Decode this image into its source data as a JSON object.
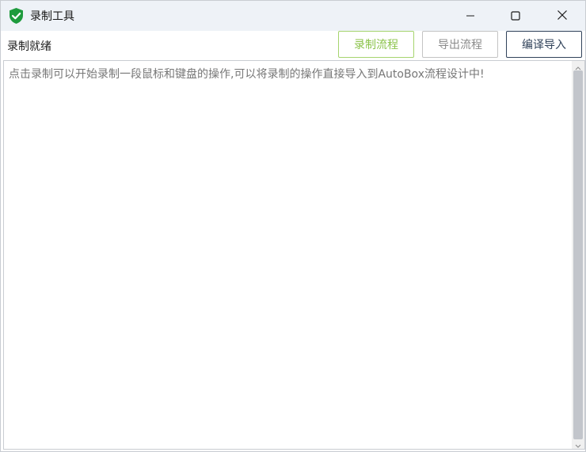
{
  "window": {
    "title": "录制工具",
    "icon": "shield-check-icon",
    "controls": {
      "minimize": "minimize-icon",
      "maximize": "maximize-icon",
      "close": "close-icon"
    }
  },
  "toolbar": {
    "status": "录制就绪",
    "record_label": "录制流程",
    "export_label": "导出流程",
    "compile_label": "编译导入"
  },
  "editor": {
    "content": "点击录制可以开始录制一段鼠标和键盘的操作,可以将录制的操作直接导入到AutoBox流程设计中!"
  },
  "colors": {
    "titlebar_bg": "#eef2f7",
    "record_accent": "#8bc34a",
    "compile_accent": "#30425a",
    "shield_green": "#1e9b3d"
  }
}
